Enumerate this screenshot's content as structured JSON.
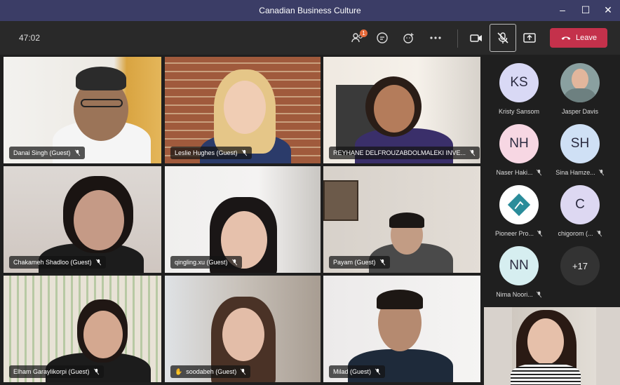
{
  "window": {
    "title": "Canadian Business Culture"
  },
  "toolbar": {
    "timer": "47:02",
    "participants_badge": "1",
    "leave_label": "Leave"
  },
  "tiles": [
    {
      "name": "Danai Singh (Guest)"
    },
    {
      "name": "Leslie Hughes (Guest)"
    },
    {
      "name": "REYHANE DELFROUZABDOLMALEKI INVE..."
    },
    {
      "name": "Chakameh Shadloo (Guest)"
    },
    {
      "name": "qingling.xu (Guest)"
    },
    {
      "name": "Payam (Guest)"
    },
    {
      "name": "Elham Garaylikorpi (Guest)"
    },
    {
      "name": "soodabeh (Guest)"
    },
    {
      "name": "Milad (Guest)"
    }
  ],
  "roster": [
    {
      "initials": "KS",
      "name": "Kristy Sansom",
      "color": "#d9d9f5"
    },
    {
      "initials": "",
      "name": "Jasper Davis",
      "color": "#8aa0a0"
    },
    {
      "initials": "NH",
      "name": "Naser Haki...",
      "color": "#f7d7e3"
    },
    {
      "initials": "SH",
      "name": "Sina Hamze...",
      "color": "#cfe0f5"
    },
    {
      "initials": "",
      "name": "Pioneer Pro...",
      "color": "#ffffff"
    },
    {
      "initials": "C",
      "name": "chigorom (...",
      "color": "#ddd8f2"
    },
    {
      "initials": "NN",
      "name": "Nima Noori...",
      "color": "#d6eef0"
    },
    {
      "initials": "+17",
      "name": "",
      "color": "#333333"
    }
  ]
}
